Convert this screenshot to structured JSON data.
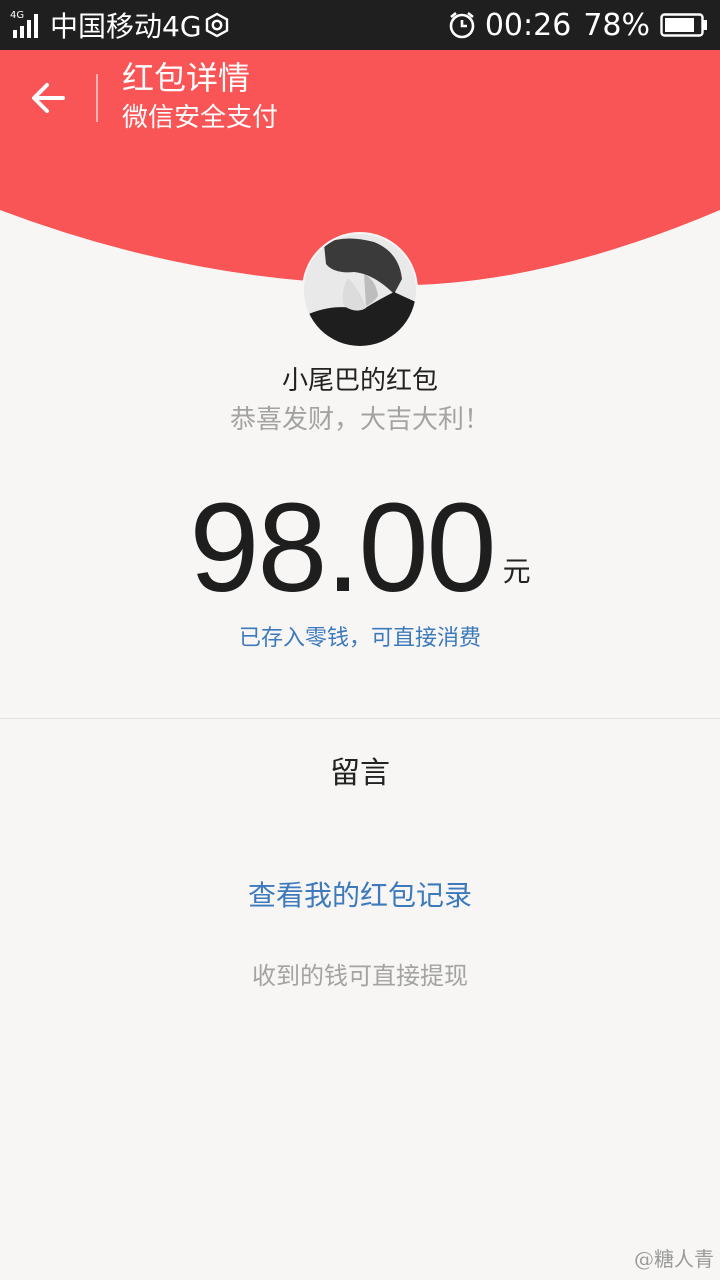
{
  "status_bar": {
    "network_tag": "4G",
    "carrier": "中国移动4G",
    "time": "00:26",
    "battery_percent": "78%",
    "icons": [
      "signal-icon",
      "hex-icon",
      "alarm-icon",
      "battery-icon"
    ]
  },
  "header": {
    "title": "红包详情",
    "subtitle": "微信安全支付",
    "back_icon": "arrow-left-icon"
  },
  "packet": {
    "sender": "小尾巴的红包",
    "greeting": "恭喜发财，大吉大利！",
    "amount": "98.00",
    "unit": "元",
    "balance_note": "已存入零钱，可直接消费"
  },
  "message": {
    "label": "留言"
  },
  "footer": {
    "records_link": "查看我的红包记录",
    "withdraw_note": "收到的钱可直接提现"
  },
  "watermark": "@糖人青",
  "colors": {
    "header_red": "#f95456",
    "link_blue": "#3d79bd",
    "status_bar": "#1f1f1f",
    "background": "#f7f6f4"
  }
}
